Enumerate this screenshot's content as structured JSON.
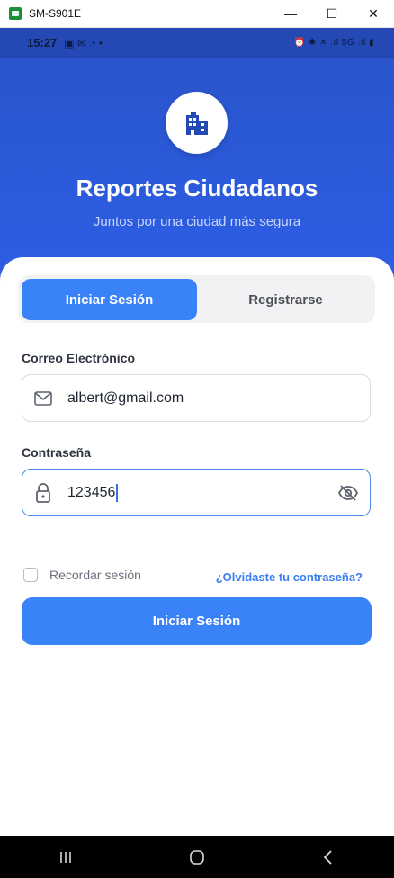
{
  "window": {
    "title": "SM-S901E",
    "minimize_glyph": "—",
    "maximize_glyph": "☐",
    "close_glyph": "✕"
  },
  "statusbar": {
    "time": "15:27",
    "left_icons": "▣ ✉ ◔ •",
    "right_icons": "⏰ ✱ ✕ .ıl 5G .ıl ▮"
  },
  "header": {
    "logo_icon": "building-icon",
    "title": "Reportes Ciudadanos",
    "subtitle": "Juntos por una ciudad más segura"
  },
  "tabs": {
    "login": "Iniciar Sesión",
    "register": "Registrarse"
  },
  "form": {
    "email_label": "Correo Electrónico",
    "email_value": "albert@gmail.com",
    "password_label": "Contraseña",
    "password_value": "123456",
    "remember_label": "Recordar sesión",
    "remember_checked": false,
    "forgot_label": "¿Olvidaste tu contraseña?",
    "submit_label": "Iniciar Sesión"
  },
  "colors": {
    "primary": "#3a82f8",
    "header_bg": "#2c5ee6",
    "link": "#3a7ff3"
  }
}
